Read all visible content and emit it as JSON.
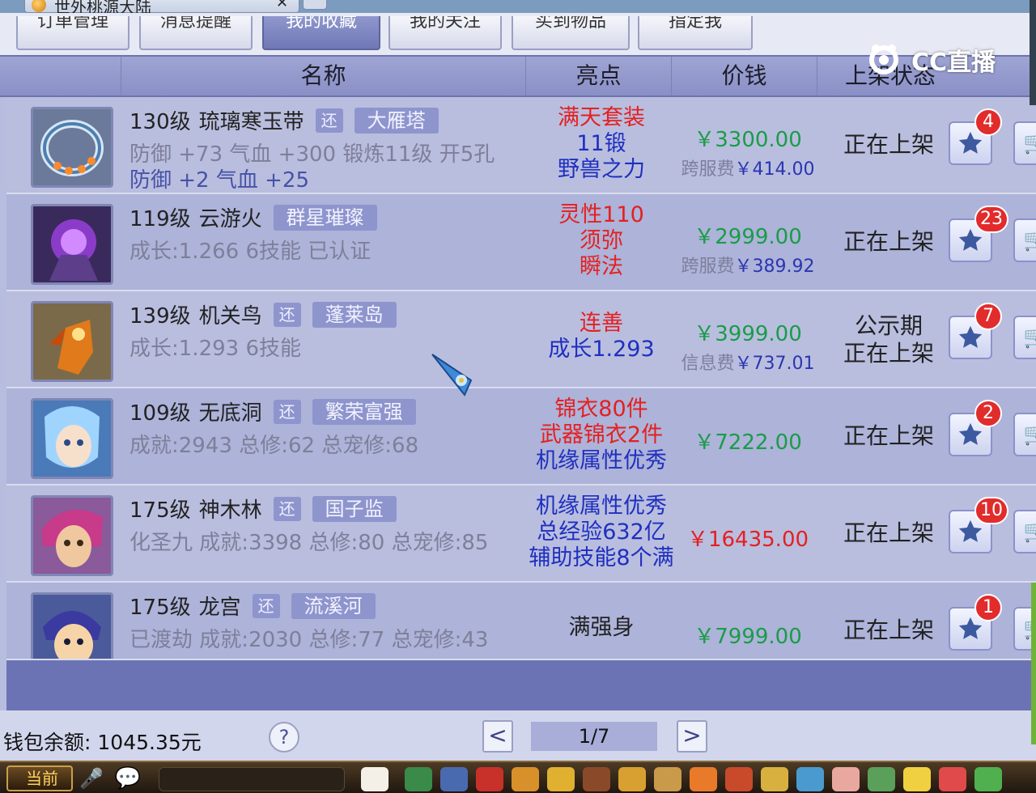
{
  "window": {
    "title": "世外桃源大陆"
  },
  "tabs": [
    {
      "label": "订单管理",
      "active": false
    },
    {
      "label": "消息提醒",
      "active": false
    },
    {
      "label": "我的收藏",
      "active": true
    },
    {
      "label": "我的关注",
      "active": false
    },
    {
      "label": "买到物品",
      "active": false
    },
    {
      "label": "指定我",
      "active": false
    }
  ],
  "watermark": {
    "text": "CC直播"
  },
  "columns": {
    "name": "名称",
    "highlight": "亮点",
    "price": "价钱",
    "status": "上架状态"
  },
  "rows": [
    {
      "level": "130级",
      "name": "琉璃寒玉带",
      "returnable": "还",
      "server": "大雁塔",
      "line2": "防御 +73 气血 +300 锻炼11级 开5孔",
      "line3": "防御 +2 气血 +25",
      "highlights": [
        {
          "text": "满天套装",
          "color": "red"
        },
        {
          "text": "11锻",
          "color": "blue"
        },
        {
          "text": "野兽之力",
          "color": "blue"
        }
      ],
      "price": "￥3300.00",
      "fee_label": "跨服费",
      "fee_value": "￥414.00",
      "status": [
        "正在上架"
      ],
      "fav_count": "4"
    },
    {
      "level": "119级",
      "name": "云游火",
      "returnable": "",
      "server": "群星璀璨",
      "line2": "成长:1.266 6技能 已认证",
      "line3": "",
      "highlights": [
        {
          "text": "灵性110",
          "color": "red"
        },
        {
          "text": "须弥",
          "color": "red"
        },
        {
          "text": "瞬法",
          "color": "red"
        }
      ],
      "price": "￥2999.00",
      "fee_label": "跨服费",
      "fee_value": "￥389.92",
      "status": [
        "正在上架"
      ],
      "fav_count": "23"
    },
    {
      "level": "139级",
      "name": "机关鸟",
      "returnable": "还",
      "server": "蓬莱岛",
      "line2": "成长:1.293 6技能",
      "line3": "",
      "highlights": [
        {
          "text": "连善",
          "color": "red"
        },
        {
          "text": "成长1.293",
          "color": "blue"
        }
      ],
      "price": "￥3999.00",
      "fee_label": "信息费",
      "fee_value": "￥737.01",
      "status": [
        "公示期",
        "正在上架"
      ],
      "fav_count": "7"
    },
    {
      "level": "109级",
      "name": "无底洞",
      "returnable": "还",
      "server": "繁荣富强",
      "line2": "成就:2943 总修:62 总宠修:68",
      "line3": "",
      "highlights": [
        {
          "text": "锦衣80件",
          "color": "red"
        },
        {
          "text": "武器锦衣2件",
          "color": "red"
        },
        {
          "text": "机缘属性优秀",
          "color": "blue"
        }
      ],
      "price": "￥7222.00",
      "fee_label": "",
      "fee_value": "",
      "status": [
        "正在上架"
      ],
      "fav_count": "2"
    },
    {
      "level": "175级",
      "name": "神木林",
      "returnable": "还",
      "server": "国子监",
      "line2": "化圣九 成就:3398 总修:80 总宠修:85",
      "line3": "",
      "highlights": [
        {
          "text": "机缘属性优秀",
          "color": "blue"
        },
        {
          "text": "总经验632亿",
          "color": "blue"
        },
        {
          "text": "辅助技能8个满",
          "color": "blue"
        }
      ],
      "price": "￥16435.00",
      "price_color": "red",
      "fee_label": "",
      "fee_value": "",
      "status": [
        "正在上架"
      ],
      "fav_count": "10"
    },
    {
      "level": "175级",
      "name": "龙宫",
      "returnable": "还",
      "server": "流溪河",
      "line2": "已渡劫 成就:2030 总修:77 总宠修:43",
      "line3": "",
      "highlights": [
        {
          "text": "满强身",
          "color": "black"
        }
      ],
      "price": "￥7999.00",
      "fee_label": "",
      "fee_value": "",
      "status": [
        "正在上架"
      ],
      "fav_count": "1"
    }
  ],
  "footer": {
    "wallet_label": "钱包余额:",
    "wallet_value": "1045.35元",
    "help": "?",
    "prev": "<",
    "page": "1/7",
    "next": ">"
  },
  "taskbar": {
    "current": "当前"
  },
  "colors": {
    "accent": "#8a90c6",
    "price_green": "#1a9c48",
    "highlight_red": "#e42020",
    "highlight_blue": "#1f2fbf",
    "badge_red": "#e22b2b"
  }
}
